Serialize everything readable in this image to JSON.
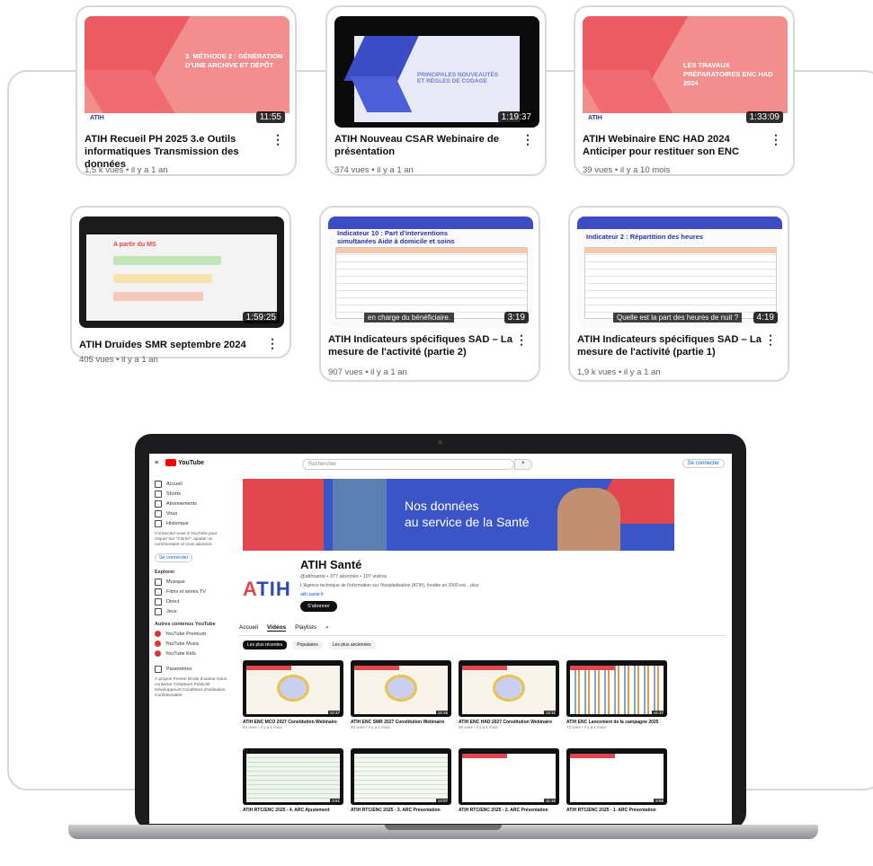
{
  "cards": [
    {
      "title": "ATIH Recueil PH 2025 3.e Outils informatiques Transmission des données",
      "meta": "1,5 k vues • il y a 1 an",
      "duration": "11:55",
      "thumb_text": "3. MÉTHODE 2 : GÉNÉRATION D'UNE ARCHIVE ET DÉPÔT",
      "thumb_logo": "ATIH"
    },
    {
      "title": "ATIH Nouveau CSAR Webinaire de présentation",
      "meta": "374 vues • il y a 1 an",
      "duration": "1:19:37",
      "thumb_text": "PRINCIPALES NOUVEAUTÉS ET RÈGLES DE CODAGE"
    },
    {
      "title": "ATIH Webinaire ENC HAD 2024 Anticiper pour restituer son ENC",
      "meta": "39 vues • il y a 10 mois",
      "duration": "1:33:09",
      "thumb_text": "LES TRAVAUX PRÉPARATOIRES ENC HAD 2024",
      "thumb_logo": "ATIH"
    },
    {
      "title": "ATIH Druides SMR septembre 2024",
      "meta": "405 vues • il y a 1 an",
      "duration": "1:59:25",
      "thumb_text": "A partir du MS"
    },
    {
      "title": "ATIH Indicateurs spécifiques SAD – La mesure de l'activité (partie 2)",
      "meta": "907 vues • il y a 1 an",
      "duration": "3:19",
      "thumb_text": "Indicateur 10 : Part d'interventions simultanées Aide à domicile et soins",
      "caption": "en charge du bénéficiaire."
    },
    {
      "title": "ATIH Indicateurs spécifiques SAD – La mesure de l'activité (partie 1)",
      "meta": "1,9 k vues • il y a 1 an",
      "duration": "4:19",
      "thumb_text": "Indicateur 2 : Répartition des heures",
      "caption": "Quelle est la part des heures de nuit ?"
    }
  ],
  "screen": {
    "search_placeholder": "Rechercher",
    "signin": "Se connecter",
    "sidebar": {
      "items": [
        "Accueil",
        "Shorts",
        "Abonnements",
        "Vous",
        "Historique"
      ],
      "prompt": "Connectez-vous à YouTube pour cliquer sur \"J'aime\", ajouter un commentaire et vous abonner.",
      "signin_btn": "Se connecter",
      "explore_title": "Explorer",
      "explore": [
        "Musique",
        "Films et séries TV",
        "Direct",
        "Jeux"
      ],
      "more_title": "Autres contenus YouTube",
      "more": [
        "YouTube Premium",
        "YouTube Music",
        "YouTube Kids"
      ],
      "settings": "Paramètres",
      "footer": "À propos Presse Droits d'auteur Nous contacter Créateurs Publicité Développeurs Conditions d'utilisation Confidentialité"
    },
    "banner": {
      "line1": "Nos données",
      "line2": "au service de la Santé"
    },
    "channel": {
      "logo": "ATIH",
      "name": "ATIH Santé",
      "meta": "@atihsante • 377 abonnés • 107 vidéos",
      "desc": "L'Agence technique de l'information sur l'hospitalisation (ATIH), fondée en 2000 est... plus",
      "link": "atih.sante.fr",
      "subscribe": "S'abonner"
    },
    "tabs": [
      "Accueil",
      "Vidéos",
      "Playlists"
    ],
    "chips": [
      "Les plus récentes",
      "Populaires",
      "Les plus anciennes"
    ],
    "videos": [
      {
        "title": "ATIH ENC MCO 2027 Constitution Webinaire",
        "meta": "54 vues • il y a 1 mois",
        "duration": "12:37"
      },
      {
        "title": "ATIH ENC SMR 2027 Constitution Webinaire",
        "meta": "33 vues • il y a 1 mois",
        "duration": "15:16"
      },
      {
        "title": "ATIH ENC HAD 2027 Constitution Webinaire",
        "meta": "25 vues • il y a 1 mois",
        "duration": "12:11"
      },
      {
        "title": "ATIH ENC Lancement de la campagne 2025",
        "meta": "72 vues • il y a 1 mois",
        "duration": "44:17"
      },
      {
        "title": "ATIH RTC/ENC 2025 - 4. ARC Ajustement",
        "meta": "",
        "duration": "4:51"
      },
      {
        "title": "ATIH RTC/ENC 2025 - 3. ARC Présentation",
        "meta": "",
        "duration": "13:37"
      },
      {
        "title": "ATIH RTC/ENC 2025 - 2. ARC Présentation",
        "meta": "",
        "duration": "11:16"
      },
      {
        "title": "ATIH RTC/ENC 2025 - 1. ARC Présentation",
        "meta": "",
        "duration": "9:58"
      }
    ]
  }
}
